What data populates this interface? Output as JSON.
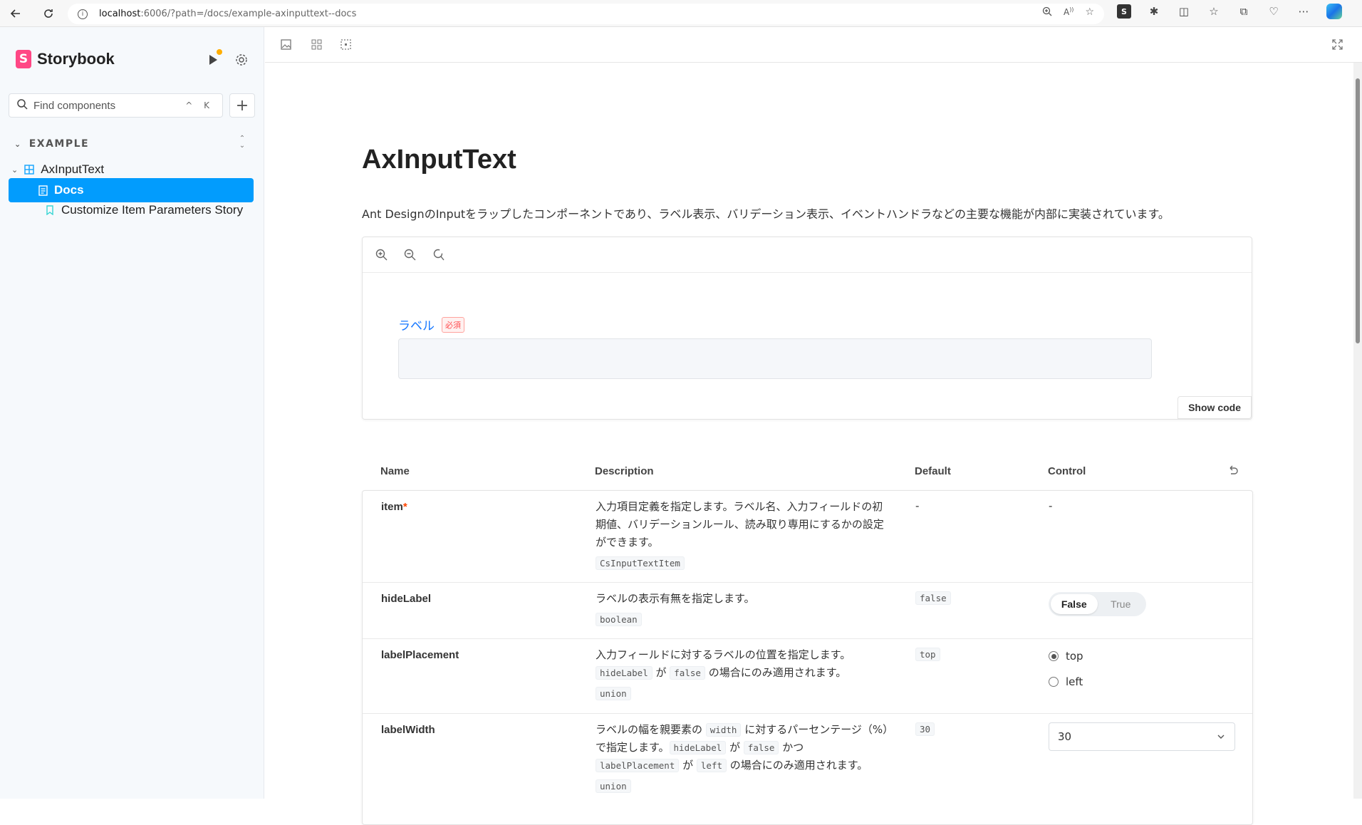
{
  "browser": {
    "url_host": "localhost",
    "url_path": ":6006/?path=/docs/example-axinputtext--docs"
  },
  "sidebar": {
    "brand": "Storybook",
    "search_placeholder": "Find components",
    "search_shortcut": "^ K",
    "section": "EXAMPLE",
    "component": "AxInputText",
    "items": [
      {
        "label": "Docs",
        "selected": true
      },
      {
        "label": "Customize Item Parameters Story",
        "selected": false
      }
    ]
  },
  "doc": {
    "title": "AxInputText",
    "description": "Ant DesignのInputをラップしたコンポーネントであり、ラベル表示、バリデーション表示、イベントハンドラなどの主要な機能が内部に実装されています。",
    "demo_label": "ラベル",
    "demo_required": "必須",
    "show_code": "Show code"
  },
  "args_table": {
    "headers": {
      "name": "Name",
      "description": "Description",
      "default": "Default",
      "control": "Control"
    },
    "rows": [
      {
        "name": "item",
        "required": "*",
        "desc": "入力項目定義を指定します。ラベル名、入力フィールドの初期値、バリデーションルール、読み取り専用にするかの設定ができます。",
        "type": "CsInputTextItem",
        "default": "-",
        "control": "-"
      },
      {
        "name": "hideLabel",
        "desc": "ラベルの表示有無を指定します。",
        "type": "boolean",
        "default": "false",
        "control_options": [
          "False",
          "True"
        ],
        "control_selected": "False"
      },
      {
        "name": "labelPlacement",
        "desc_prefix": "入力フィールドに対するラベルの位置を指定します。",
        "desc_code1": "hideLabel",
        "desc_mid": " が ",
        "desc_code2": "false",
        "desc_suffix": " の場合にのみ適用されます。",
        "type": "union",
        "default": "top",
        "control_options": [
          "top",
          "left"
        ],
        "control_selected": "top"
      },
      {
        "name": "labelWidth",
        "desc_p1": "ラベルの幅を親要素の ",
        "desc_c1": "width",
        "desc_p2": " に対するパーセンテージ（%）で指定します。",
        "desc_c2": "hideLabel",
        "desc_p3": " が ",
        "desc_c3": "false",
        "desc_p4": " かつ ",
        "desc_c4": "labelPlacement",
        "desc_p5": " が ",
        "desc_c5": "left",
        "desc_p6": " の場合にのみ適用されます。",
        "type": "union",
        "default": "30",
        "control_value": "30"
      }
    ]
  }
}
